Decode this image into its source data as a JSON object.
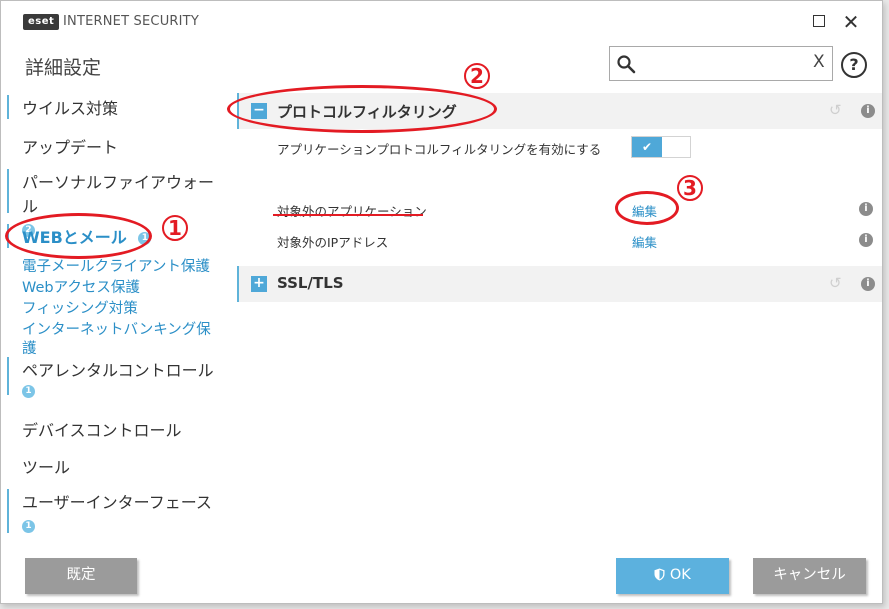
{
  "titlebar": {
    "logo": "eset",
    "product": "INTERNET SECURITY",
    "maximize_icon": "maximize-icon",
    "close_icon": "close-icon",
    "close_glyph": "✕"
  },
  "header": {
    "title": "詳細設定",
    "search_placeholder": "",
    "search_clear": "X",
    "help": "?"
  },
  "sidebar": {
    "items": [
      {
        "label": "ウイルス対策"
      },
      {
        "label": "アップデート"
      },
      {
        "label": "パーソナルファイアウォール",
        "badge": "2"
      },
      {
        "label": "WEBとメール",
        "badge": "1",
        "active": true
      },
      {
        "label": "ペアレンタルコントロール",
        "badge": "1"
      },
      {
        "label": "デバイスコントロール"
      },
      {
        "label": "ツール"
      },
      {
        "label": "ユーザーインターフェース",
        "badge": "1"
      }
    ],
    "sub_items": [
      {
        "label": "電子メールクライアント保護"
      },
      {
        "label": "Webアクセス保護"
      },
      {
        "label": "フィッシング対策"
      },
      {
        "label": "インターネットバンキング保",
        "label2": "護"
      }
    ]
  },
  "sections": [
    {
      "toggle": "−",
      "title": "プロトコルフィルタリング",
      "rows": [
        {
          "label": "アプリケーションプロトコルフィルタリングを有効にする",
          "enabled": true,
          "check": "✔"
        },
        {
          "label": "対象外のアプリケーション",
          "link": "編集"
        },
        {
          "label": "対象外のIPアドレス",
          "link": "編集"
        }
      ]
    },
    {
      "toggle": "+",
      "title": "SSL/TLS"
    }
  ],
  "icons": {
    "revert": "↺",
    "info": "i"
  },
  "annotations": {
    "n1": "1",
    "n2": "2",
    "n3": "3"
  },
  "footer": {
    "default": "既定",
    "ok": "OK",
    "cancel": "キャンセル"
  }
}
